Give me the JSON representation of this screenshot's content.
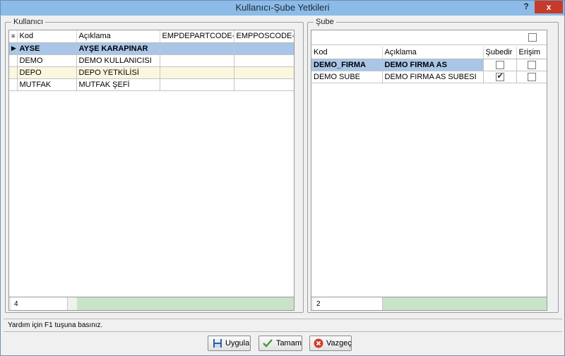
{
  "window": {
    "title": "Kullanıcı-Şube Yetkileri",
    "help_label": "?",
    "close_label": "x"
  },
  "kullanici": {
    "legend": "Kullanıcı",
    "columns": [
      "Kod",
      "Açıklama",
      "EMPDEPARTCODE-",
      "EMPPOSCODE-"
    ],
    "rows": [
      {
        "kod": "AYSE",
        "aciklama": "AYŞE KARAPINAR",
        "dept": "",
        "pos": ""
      },
      {
        "kod": "DEMO",
        "aciklama": "DEMO KULLANICISI",
        "dept": "",
        "pos": ""
      },
      {
        "kod": "DEPO",
        "aciklama": "DEPO YETKİLİSİ",
        "dept": "",
        "pos": ""
      },
      {
        "kod": "MUTFAK",
        "aciklama": "MUTFAK ŞEFİ",
        "dept": "",
        "pos": ""
      }
    ],
    "count": "4"
  },
  "sube": {
    "legend": "Şube",
    "columns": [
      "Kod",
      "Açıklama",
      "Şubedir",
      "Erişim"
    ],
    "rows": [
      {
        "kod": "DEMO_FIRMA",
        "aciklama": "DEMO FIRMA AS",
        "subedir": false,
        "erisim": false
      },
      {
        "kod": "DEMO SUBE",
        "aciklama": "DEMO FIRMA AS SUBESI",
        "subedir": true,
        "erisim": false
      }
    ],
    "count": "2"
  },
  "status": "Yardım için F1 tuşuna basınız.",
  "buttons": {
    "apply": "Uygula",
    "ok": "Tamam",
    "cancel": "Vazgeç"
  },
  "colors": {
    "selected_row": "#a9c6e8",
    "alt_row": "#fbf7df",
    "footer_green": "#c9e3c8",
    "titlebar": "#8bbbe6",
    "close": "#c7392b"
  }
}
